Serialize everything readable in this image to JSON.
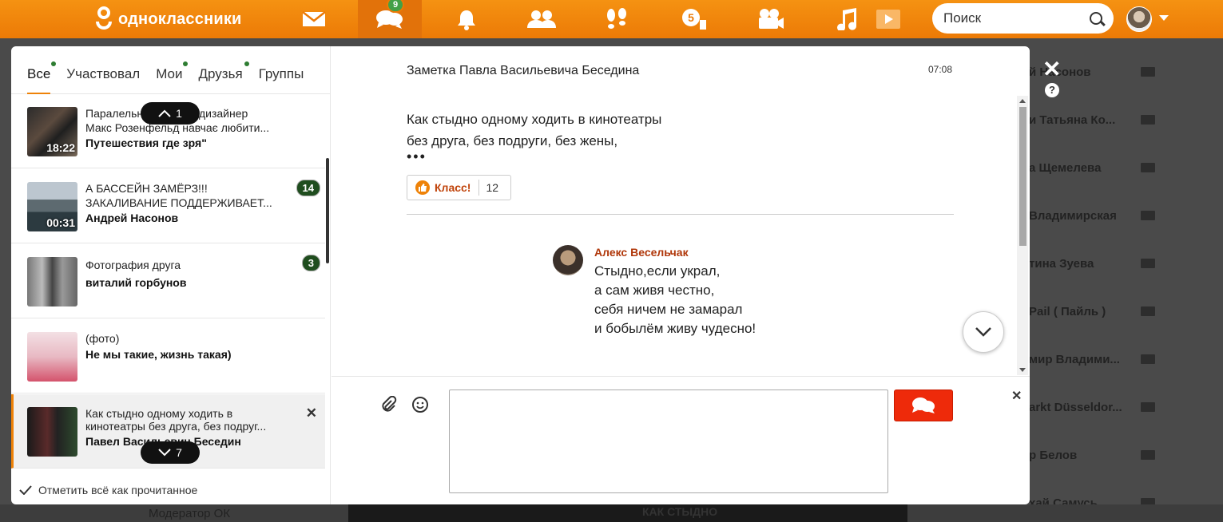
{
  "header": {
    "logo_text": "одноклассники",
    "messages_badge": "9",
    "notifications_badge": "5",
    "search_placeholder": "Поиск"
  },
  "tabs": [
    {
      "label": "Все"
    },
    {
      "label": "Участвовал"
    },
    {
      "label": "Мои"
    },
    {
      "label": "Друзья"
    },
    {
      "label": "Группы"
    }
  ],
  "conversations": [
    {
      "line1": "Паралельний світ. Як дизайнер",
      "line2": "Макс Розенфельд навчає любити...",
      "author": "Путешествия где зря\"",
      "duration": "18:22"
    },
    {
      "line1": "А БАССЕЙН ЗАМЁРЗ!!!",
      "line2": "ЗАКАЛИВАНИЕ ПОДДЕРЖИВАЕТ...",
      "author": "Андрей Насонов",
      "duration": "00:31",
      "count": "14"
    },
    {
      "line1": "Фотография друга",
      "author": "виталий горбунов",
      "count": "3"
    },
    {
      "line1": "(фото)",
      "author": "Не мы такие, жизнь такая)"
    },
    {
      "line1": "Как стыдно одному ходить в",
      "line2": "кинотеатры без друга, без подруг...",
      "author": "Павел Васильевич Беседин"
    }
  ],
  "scroll_up_count": "1",
  "scroll_down_count": "7",
  "mark_all_read": "Отметить всё как прочитанное",
  "chat": {
    "title": "Заметка Павла Васильевича Беседина",
    "time": "07:08",
    "note_line1": "Как стыдно одному ходить в кинотеатры",
    "note_line2": "без друга, без подруги, без жены,",
    "note_more": "•••",
    "klass_label": "Класс!",
    "klass_count": "12",
    "comment": {
      "author": "Алекс Весельчак",
      "lines": [
        "Стыдно,если украл,",
        "а сам живя честно,",
        "себя ничем не замарал",
        "и бобылём живу чудесно!"
      ]
    }
  },
  "background_list": [
    {
      "name": "й Насонов"
    },
    {
      "name": "и Татьяна Ко..."
    },
    {
      "name": "а Щемелева"
    },
    {
      "name": "Владимирская"
    },
    {
      "name": "тина Зуева"
    },
    {
      "name": "Pail ( Пайль )"
    },
    {
      "name": "мир Владими..."
    },
    {
      "name": "arkt Düsseldor..."
    },
    {
      "name": "р Белов"
    },
    {
      "name": "хай Самусь"
    }
  ],
  "background_bottom": {
    "left_text": "Модератор ОК",
    "center_text": "КАК СТЫДНО"
  },
  "colors": {
    "brand_orange": "#ee8208",
    "send_red": "#ee2a0a",
    "badge_green": "#1f4d1e"
  }
}
